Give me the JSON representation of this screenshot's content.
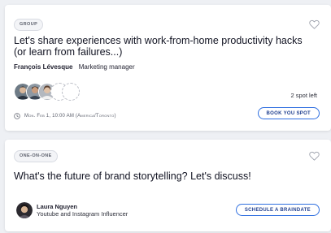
{
  "cards": [
    {
      "type_label": "Group",
      "title": "Let's share experiences with work-from-home productivity hacks (or learn from failures...)",
      "host_name": "François Lévesque",
      "host_role": "Marketing manager",
      "spots": "2 spot left",
      "date": "Mon. Feb 1, 10:00 AM (America/Toronto)",
      "button_label": "Book you spot"
    },
    {
      "type_label": "One-on-one",
      "title": "What's the future of brand storytelling? Let's discuss!",
      "host_name": "Laura Nguyen",
      "host_role": "Youtube and Instagram Influencer",
      "button_label": "Schedule a braindate"
    }
  ],
  "icons": {
    "favorite": "heart-outline-icon",
    "time": "clock-icon"
  },
  "colors": {
    "accent_border": "#2f6fe0",
    "button_text": "#1f3f8f"
  }
}
